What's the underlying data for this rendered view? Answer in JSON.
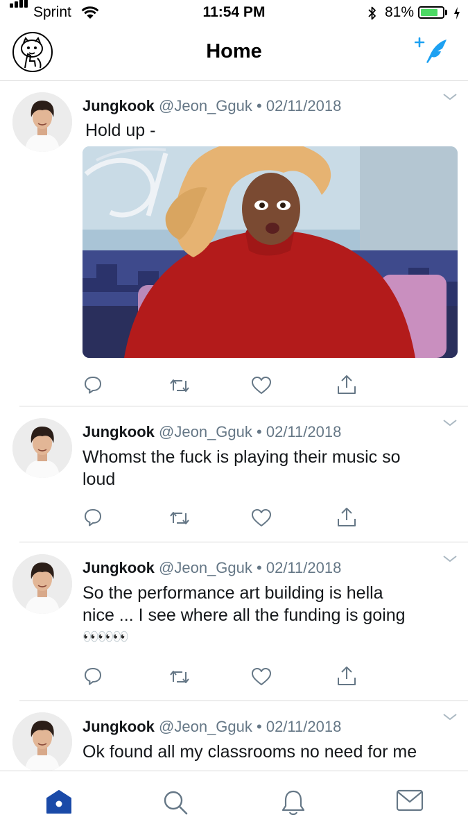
{
  "status_bar": {
    "carrier": "Sprint",
    "time": "11:54 PM",
    "battery_pct": "81%",
    "battery_level": 0.81,
    "icons": [
      "signal-icon",
      "wifi-icon",
      "bluetooth-icon",
      "battery-icon",
      "charging-icon"
    ]
  },
  "header": {
    "title": "Home",
    "icons": [
      "profile-avatar",
      "compose-tweet-icon"
    ]
  },
  "colors": {
    "accent": "#1da1f2",
    "tab_active": "#1a4aa8",
    "icon_gray": "#657786",
    "battery": "#4cd964"
  },
  "tweets": [
    {
      "name": "Jungkook",
      "handle": "@Jeon_Gguk",
      "separator": "•",
      "date": "02/11/2018",
      "text": "Hold up -",
      "has_media": true
    },
    {
      "name": "Jungkook",
      "handle": "@Jeon_Gguk",
      "separator": "•",
      "date": "02/11/2018",
      "lines": [
        "Whomst the fuck is playing their music so",
        "loud"
      ]
    },
    {
      "name": "Jungkook",
      "handle": "@Jeon_Gguk",
      "separator": "•",
      "date": "02/11/2018",
      "lines": [
        "So the performance art building is hella",
        "nice ... I see where all the funding is going"
      ],
      "emoji": "👀👀👀"
    },
    {
      "name": "Jungkook",
      "handle": "@Jeon_Gguk",
      "separator": "•",
      "date": "02/11/2018",
      "lines": [
        "Ok found all my classrooms no need for me"
      ]
    }
  ],
  "tweet_actions": [
    "reply-icon",
    "retweet-icon",
    "like-icon",
    "share-icon"
  ],
  "tab_bar": {
    "tabs": [
      "home-tab",
      "search-tab",
      "notifications-tab",
      "messages-tab"
    ],
    "active": "home-tab"
  }
}
